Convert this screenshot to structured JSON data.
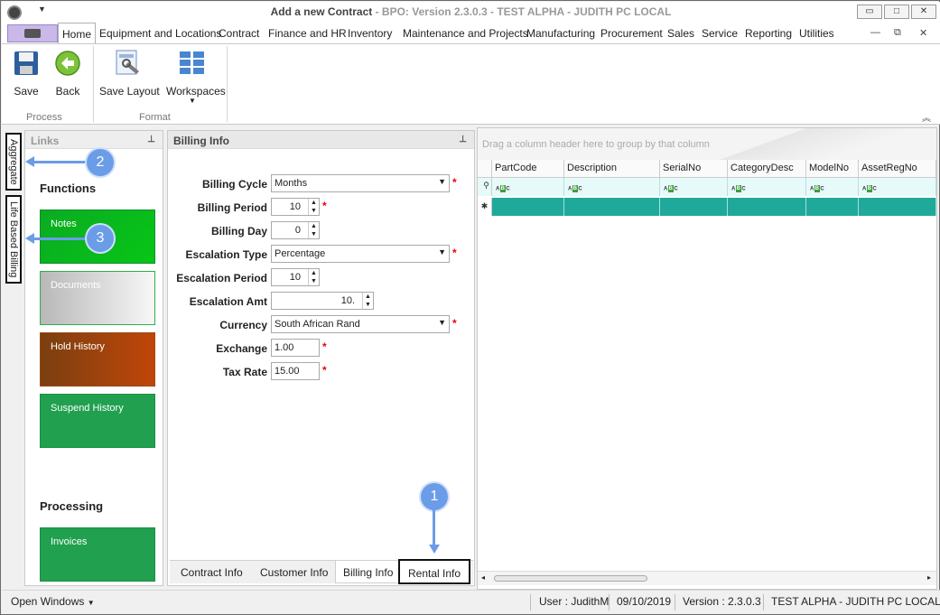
{
  "window": {
    "title_main": "Add a new Contract",
    "title_rest": " - BPO: Version 2.3.0.3 - TEST ALPHA - JUDITH PC LOCAL",
    "min": "▭",
    "max": "□",
    "close": "✕"
  },
  "menu": {
    "items": [
      "Home",
      "Equipment and Locations",
      "Contract",
      "Finance and HR",
      "Inventory",
      "Maintenance and Projects",
      "Manufacturing",
      "Procurement",
      "Sales",
      "Service",
      "Reporting",
      "Utilities"
    ],
    "active": "Home"
  },
  "ribbon": {
    "save": "Save",
    "back": "Back",
    "save_layout": "Save Layout",
    "workspaces": "Workspaces",
    "group_process": "Process",
    "group_format": "Format"
  },
  "vtabs": {
    "aggregate": "Aggregate",
    "life_based_billing": "Life Based Billing"
  },
  "links": {
    "header": "Links",
    "functions_title": "Functions",
    "functions": [
      {
        "label": "Notes",
        "color": "#0aab22"
      },
      {
        "label": "Documents",
        "color": "#cfcfcf"
      },
      {
        "label": "Hold History",
        "color": "#8b4513"
      },
      {
        "label": "Suspend History",
        "color": "#21a050"
      }
    ],
    "processing_title": "Processing",
    "processing": [
      {
        "label": "Invoices",
        "color": "#21a050"
      }
    ]
  },
  "billing": {
    "header": "Billing Info",
    "fields": {
      "billing_cycle": {
        "label": "Billing Cycle",
        "value": "Months"
      },
      "billing_period": {
        "label": "Billing Period",
        "value": "10"
      },
      "billing_day": {
        "label": "Billing Day",
        "value": "0"
      },
      "escalation_type": {
        "label": "Escalation Type",
        "value": "Percentage"
      },
      "escalation_period": {
        "label": "Escalation Period",
        "value": "10"
      },
      "escalation_amt": {
        "label": "Escalation Amt",
        "value": "10."
      },
      "currency": {
        "label": "Currency",
        "value": "South African Rand"
      },
      "exchange": {
        "label": "Exchange",
        "value": "1.00"
      },
      "tax_rate": {
        "label": "Tax Rate",
        "value": "15.00"
      }
    },
    "required_mark": "*",
    "tabs": [
      "Contract Info",
      "Customer Info",
      "Billing Info",
      "Rental Info"
    ],
    "active_tab": "Billing Info"
  },
  "grid": {
    "group_hint": "Drag a column header here to group by that column",
    "columns": [
      "PartCode",
      "Description",
      "SerialNo",
      "CategoryDesc",
      "ModelNo",
      "AssetRegNo"
    ],
    "filter_icon": "abc-filter-icon"
  },
  "status": {
    "open_windows": "Open Windows",
    "user": "User : JudithM",
    "date": "09/10/2019",
    "version": "Version : 2.3.0.3",
    "env": "TEST ALPHA - JUDITH PC LOCAL"
  },
  "callouts": [
    "1",
    "2",
    "3"
  ]
}
